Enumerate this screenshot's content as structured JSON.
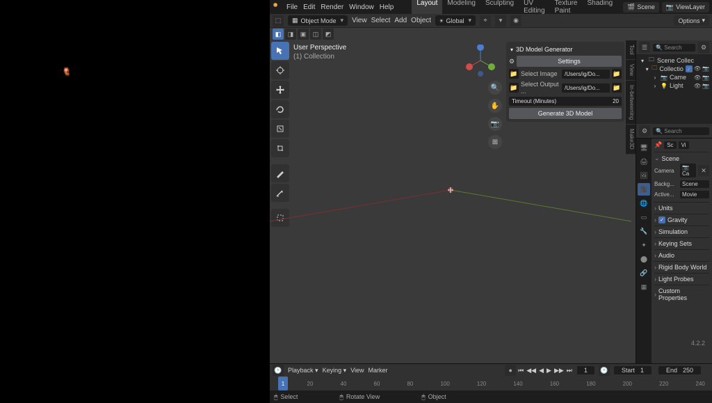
{
  "topmenu": [
    "File",
    "Edit",
    "Render",
    "Window",
    "Help"
  ],
  "workspaces": [
    "Layout",
    "Modeling",
    "Sculpting",
    "UV Editing",
    "Texture Paint",
    "Shading"
  ],
  "scene_pill": "Scene",
  "layer_pill": "ViewLayer",
  "header": {
    "mode": "Object Mode",
    "menus": [
      "View",
      "Select",
      "Add",
      "Object"
    ],
    "orientation": "Global",
    "options": "Options"
  },
  "perspective": {
    "line1": "User Perspective",
    "line2": "(1) Collection"
  },
  "side_tabs": [
    "Tool",
    "View",
    "In-betweening",
    "Make3D"
  ],
  "addon": {
    "title": "3D Model Generator",
    "settings": "Settings",
    "select_image": "Select Image",
    "image_path": "/Users/ig/Do...",
    "select_output": "Select Output ...",
    "output_path": "/Users/ig/Do...",
    "timeout_label": "Timeout (Minutes)",
    "timeout_value": "20",
    "generate": "Generate 3D Model"
  },
  "outliner": {
    "search": "Search",
    "root": "Scene Collec",
    "coll": "Collectio",
    "cam": "Came",
    "light": "Light"
  },
  "props": {
    "search": "Search",
    "pills": [
      "Sc",
      "Vi"
    ],
    "scene_header": "Scene",
    "camera_label": "Camera",
    "camera_value": "Ca",
    "backg_label": "Backg...",
    "backg_value": "Scene",
    "active_label": "Active...",
    "active_value": "Movie",
    "sections": [
      "Units",
      "Gravity",
      "Simulation",
      "Keying Sets",
      "Audio",
      "Rigid Body World",
      "Light Probes",
      "Custom Properties"
    ]
  },
  "timeline": {
    "menus": [
      "Playback",
      "Keying",
      "View",
      "Marker"
    ],
    "current": "1",
    "start_label": "Start",
    "start": "1",
    "end_label": "End",
    "end": "250",
    "ticks": [
      "20",
      "40",
      "60",
      "80",
      "100",
      "120",
      "140",
      "160",
      "180",
      "200",
      "220",
      "240"
    ]
  },
  "status": {
    "select": "Select",
    "rotate": "Rotate View",
    "object": "Object"
  },
  "version": "4.2.2"
}
